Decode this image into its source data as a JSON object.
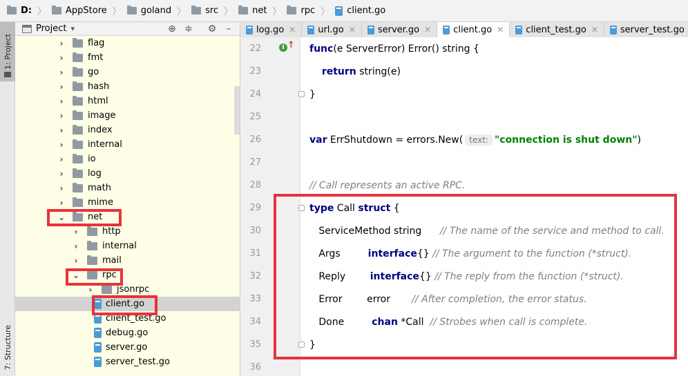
{
  "breadcrumb": {
    "drive": "D:",
    "items": [
      "AppStore",
      "goland",
      "src",
      "net",
      "rpc"
    ],
    "file": "client.go"
  },
  "sidebar": {
    "project_label": "1: Project",
    "structure_label": "7: Structure"
  },
  "panel": {
    "title": "Project",
    "title_caret": "▾",
    "buttons": [
      "⊕",
      "≑",
      "⚙",
      "–"
    ]
  },
  "tree": [
    {
      "label": "flag",
      "type": "folder",
      "expand": "collapsed",
      "indent": 0
    },
    {
      "label": "fmt",
      "type": "folder",
      "expand": "collapsed",
      "indent": 0
    },
    {
      "label": "go",
      "type": "folder",
      "expand": "collapsed",
      "indent": 0
    },
    {
      "label": "hash",
      "type": "folder",
      "expand": "collapsed",
      "indent": 0
    },
    {
      "label": "html",
      "type": "folder",
      "expand": "collapsed",
      "indent": 0
    },
    {
      "label": "image",
      "type": "folder",
      "expand": "collapsed",
      "indent": 0
    },
    {
      "label": "index",
      "type": "folder",
      "expand": "collapsed",
      "indent": 0
    },
    {
      "label": "internal",
      "type": "folder",
      "expand": "collapsed",
      "indent": 0
    },
    {
      "label": "io",
      "type": "folder",
      "expand": "collapsed",
      "indent": 0
    },
    {
      "label": "log",
      "type": "folder",
      "expand": "collapsed",
      "indent": 0
    },
    {
      "label": "math",
      "type": "folder",
      "expand": "collapsed",
      "indent": 0
    },
    {
      "label": "mime",
      "type": "folder",
      "expand": "collapsed",
      "indent": 0
    },
    {
      "label": "net",
      "type": "folder",
      "expand": "expanded",
      "indent": 0
    },
    {
      "label": "http",
      "type": "folder",
      "expand": "collapsed",
      "indent": 1
    },
    {
      "label": "internal",
      "type": "folder",
      "expand": "collapsed",
      "indent": 1
    },
    {
      "label": "mail",
      "type": "folder",
      "expand": "collapsed",
      "indent": 1
    },
    {
      "label": "rpc",
      "type": "folder",
      "expand": "expanded",
      "indent": 1
    },
    {
      "label": "jsonrpc",
      "type": "folder",
      "expand": "collapsed",
      "indent": 2
    },
    {
      "label": "client.go",
      "type": "file",
      "expand": "none",
      "indent": 2,
      "selected": true
    },
    {
      "label": "client_test.go",
      "type": "file",
      "expand": "none",
      "indent": 2
    },
    {
      "label": "debug.go",
      "type": "file",
      "expand": "none",
      "indent": 2
    },
    {
      "label": "server.go",
      "type": "file",
      "expand": "none",
      "indent": 2
    },
    {
      "label": "server_test.go",
      "type": "file",
      "expand": "none",
      "indent": 2
    }
  ],
  "tabs": [
    {
      "label": "log.go",
      "active": false
    },
    {
      "label": "url.go",
      "active": false
    },
    {
      "label": "server.go",
      "active": false
    },
    {
      "label": "client.go",
      "active": true
    },
    {
      "label": "client_test.go",
      "active": false
    },
    {
      "label": "server_test.go",
      "active": false
    }
  ],
  "code_lines": [
    {
      "n": "22",
      "fold": false,
      "segments": [
        [
          "kw",
          "func"
        ],
        [
          "",
          "(e ServerError) Error() string {"
        ]
      ]
    },
    {
      "n": "23",
      "fold": false,
      "segments": [
        [
          "",
          "    "
        ],
        [
          "kw",
          "return"
        ],
        [
          "",
          " string(e)"
        ]
      ]
    },
    {
      "n": "24",
      "fold": true,
      "segments": [
        [
          "",
          "}"
        ]
      ]
    },
    {
      "n": "25",
      "fold": false,
      "segments": []
    },
    {
      "n": "26",
      "fold": false,
      "segments": [
        [
          "kw",
          "var"
        ],
        [
          "",
          " ErrShutdown = errors.New("
        ],
        [
          "hint",
          "text:"
        ],
        [
          "str",
          "\"connection is shut down\""
        ],
        [
          "",
          ")"
        ]
      ]
    },
    {
      "n": "27",
      "fold": false,
      "segments": []
    },
    {
      "n": "28",
      "fold": false,
      "segments": [
        [
          "cmt",
          "// Call represents an active RPC."
        ]
      ]
    },
    {
      "n": "29",
      "fold": true,
      "segments": [
        [
          "kw",
          "type"
        ],
        [
          "",
          " Call "
        ],
        [
          "kw",
          "struct"
        ],
        [
          "",
          " {"
        ]
      ]
    },
    {
      "n": "30",
      "fold": false,
      "segments": [
        [
          "",
          "   ServiceMethod string      "
        ],
        [
          "cmt",
          "// The name of the service and method to call."
        ]
      ]
    },
    {
      "n": "31",
      "fold": false,
      "segments": [
        [
          "",
          "   Args         "
        ],
        [
          "kw",
          "interface"
        ],
        [
          "",
          "{} "
        ],
        [
          "cmt",
          "// The argument to the function (*struct)."
        ]
      ]
    },
    {
      "n": "32",
      "fold": false,
      "segments": [
        [
          "",
          "   Reply        "
        ],
        [
          "kw",
          "interface"
        ],
        [
          "",
          "{} "
        ],
        [
          "cmt",
          "// The reply from the function (*struct)."
        ]
      ]
    },
    {
      "n": "33",
      "fold": false,
      "segments": [
        [
          "",
          "   Error        error       "
        ],
        [
          "cmt",
          "// After completion, the error status."
        ]
      ]
    },
    {
      "n": "34",
      "fold": false,
      "segments": [
        [
          "",
          "   Done         "
        ],
        [
          "kw",
          "chan"
        ],
        [
          "",
          " *Call  "
        ],
        [
          "cmt",
          "// Strobes when call is complete."
        ]
      ]
    },
    {
      "n": "35",
      "fold": true,
      "segments": [
        [
          "",
          "}"
        ]
      ]
    },
    {
      "n": "36",
      "fold": false,
      "segments": []
    }
  ],
  "impl_marker": {
    "badge": "I",
    "arrow": "↑"
  },
  "colors": {
    "highlight": "#e8323c",
    "keyword": "#000080",
    "string": "#008000",
    "comment": "#808080",
    "tree_bg": "#fffee6"
  }
}
